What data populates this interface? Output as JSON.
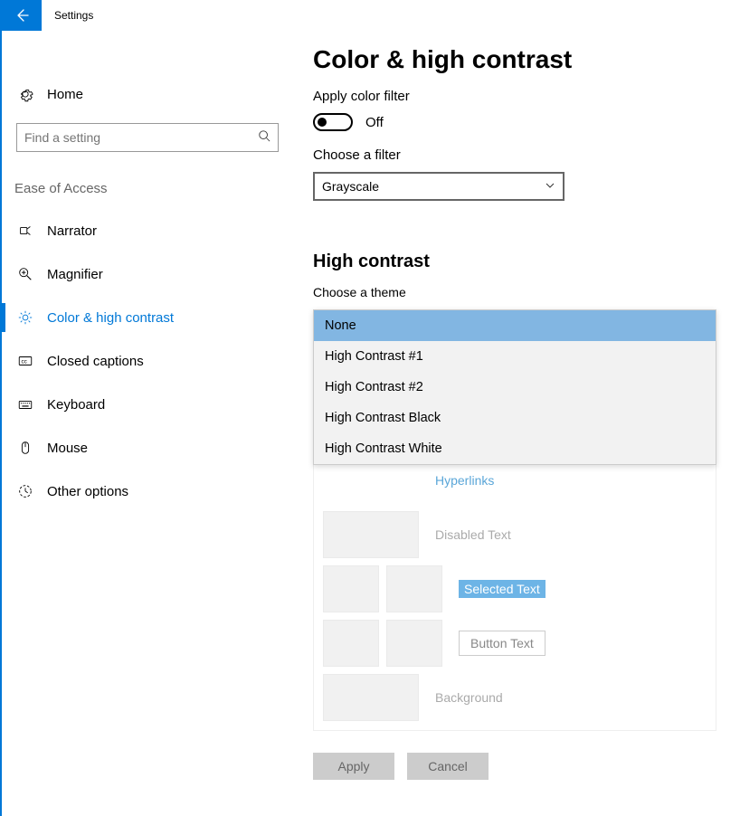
{
  "titlebar": {
    "app_name": "Settings"
  },
  "sidebar": {
    "home_label": "Home",
    "search_placeholder": "Find a setting",
    "category_header": "Ease of Access",
    "items": [
      {
        "label": "Narrator"
      },
      {
        "label": "Magnifier"
      },
      {
        "label": "Color & high contrast"
      },
      {
        "label": "Closed captions"
      },
      {
        "label": "Keyboard"
      },
      {
        "label": "Mouse"
      },
      {
        "label": "Other options"
      }
    ]
  },
  "main": {
    "page_title": "Color & high contrast",
    "apply_filter_label": "Apply color filter",
    "toggle_state": "Off",
    "choose_filter_label": "Choose a filter",
    "filter_value": "Grayscale",
    "high_contrast_heading": "High contrast",
    "choose_theme_label": "Choose a theme",
    "theme_options": [
      "None",
      "High Contrast #1",
      "High Contrast #2",
      "High Contrast Black",
      "High Contrast White"
    ],
    "preview": {
      "hyperlinks": "Hyperlinks",
      "disabled_text": "Disabled Text",
      "selected_text": "Selected Text",
      "button_text": "Button Text",
      "background": "Background"
    },
    "apply_button": "Apply",
    "cancel_button": "Cancel"
  }
}
